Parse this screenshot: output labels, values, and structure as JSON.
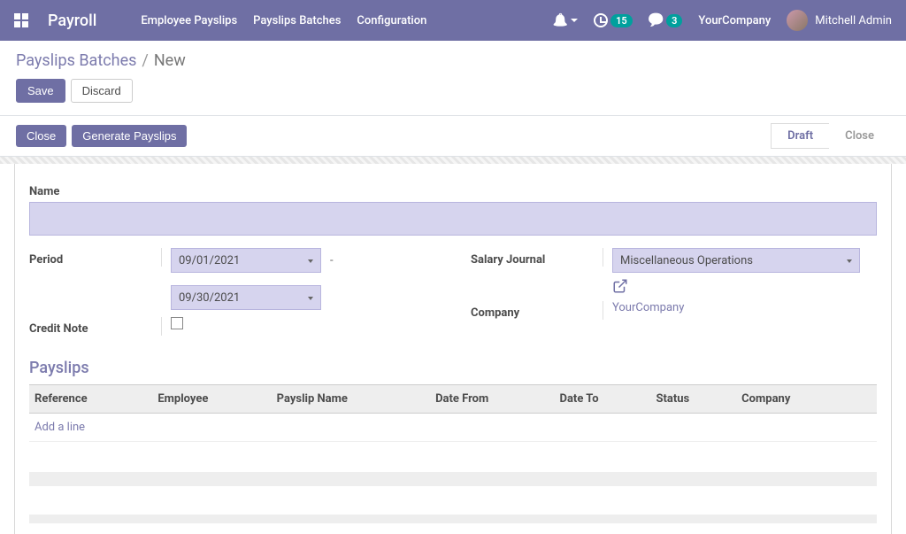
{
  "topnav": {
    "brand": "Payroll",
    "links": [
      "Employee Payslips",
      "Payslips Batches",
      "Configuration"
    ],
    "clock_badge": "15",
    "chat_badge": "3",
    "company": "YourCompany",
    "user": "Mitchell Admin"
  },
  "breadcrumb": {
    "parent": "Payslips Batches",
    "current": "New"
  },
  "buttons": {
    "save": "Save",
    "discard": "Discard",
    "close": "Close",
    "generate": "Generate Payslips"
  },
  "status": {
    "draft": "Draft",
    "close": "Close"
  },
  "form": {
    "name_label": "Name",
    "name_value": "",
    "period_label": "Period",
    "date_start": "09/01/2021",
    "date_end": "09/30/2021",
    "credit_note_label": "Credit Note",
    "salary_journal_label": "Salary Journal",
    "salary_journal_value": "Miscellaneous Operations",
    "company_label": "Company",
    "company_value": "YourCompany"
  },
  "payslips": {
    "title": "Payslips",
    "columns": [
      "Reference",
      "Employee",
      "Payslip Name",
      "Date From",
      "Date To",
      "Status",
      "Company"
    ],
    "add_line": "Add a line"
  }
}
